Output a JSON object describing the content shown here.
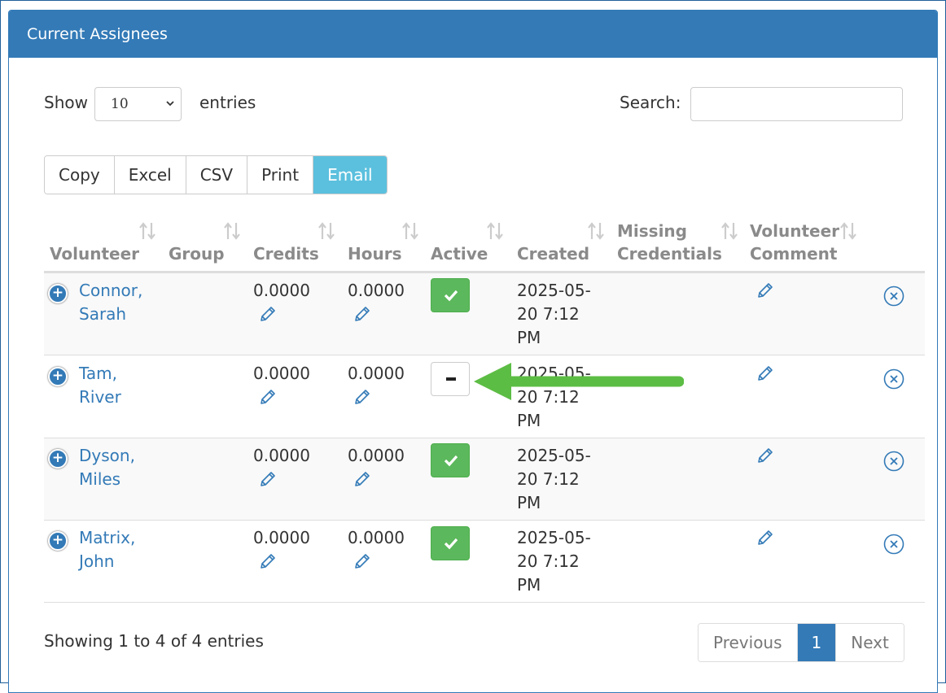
{
  "panel": {
    "title": "Current Assignees"
  },
  "length": {
    "show_label": "Show",
    "value": "10",
    "entries_label": "entries"
  },
  "search": {
    "label": "Search:",
    "value": ""
  },
  "buttons": {
    "copy": "Copy",
    "excel": "Excel",
    "csv": "CSV",
    "print": "Print",
    "email": "Email"
  },
  "table": {
    "headers": {
      "volunteer": "Volunteer",
      "group": "Group",
      "credits": "Credits",
      "hours": "Hours",
      "active": "Active",
      "created": "Created",
      "missing_1": "Missing",
      "missing_2": "Credentials",
      "comment_1": "Volunteer",
      "comment_2": "Comment"
    },
    "rows": [
      {
        "name_1": "Connor,",
        "name_2": "Sarah",
        "credits": "0.0000",
        "hours": "0.0000",
        "active": true,
        "created_1": "2025-05-",
        "created_2": "20 7:12",
        "created_3": "PM"
      },
      {
        "name_1": "Tam,",
        "name_2": "River",
        "credits": "0.0000",
        "hours": "0.0000",
        "active": false,
        "created_1": "2025-05-",
        "created_2": "20 7:12",
        "created_3": "PM"
      },
      {
        "name_1": "Dyson,",
        "name_2": "Miles",
        "credits": "0.0000",
        "hours": "0.0000",
        "active": true,
        "created_1": "2025-05-",
        "created_2": "20 7:12",
        "created_3": "PM"
      },
      {
        "name_1": "Matrix,",
        "name_2": "John",
        "credits": "0.0000",
        "hours": "0.0000",
        "active": true,
        "created_1": "2025-05-",
        "created_2": "20 7:12",
        "created_3": "PM"
      }
    ]
  },
  "footer": {
    "info": "Showing 1 to 4 of 4 entries"
  },
  "pagination": {
    "previous": "Previous",
    "current": "1",
    "next": "Next"
  },
  "colors": {
    "primary": "#337ab7",
    "success": "#5cb85c",
    "info": "#5bc0de",
    "annotation_arrow": "#5cbd44"
  }
}
